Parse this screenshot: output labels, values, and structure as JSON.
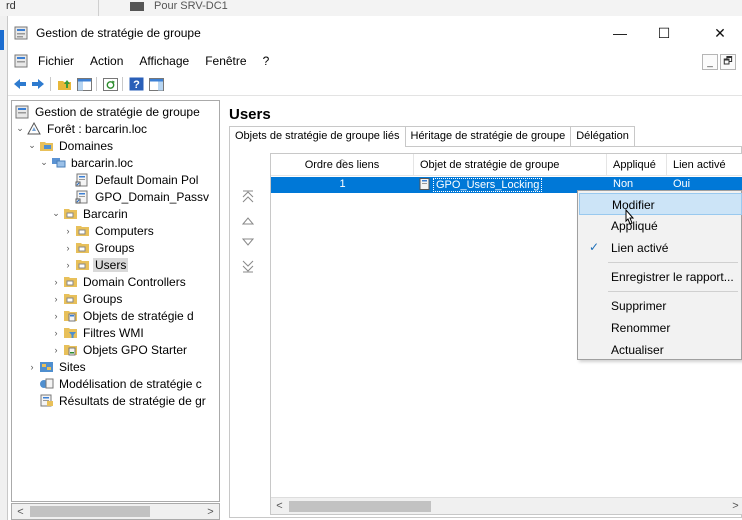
{
  "background": {
    "left_text": "rd",
    "window_text": "Pour SRV-DC1"
  },
  "window": {
    "title": "Gestion de stratégie de groupe",
    "controls": {
      "minimize": "—",
      "maximize": "☐",
      "close": "✕"
    }
  },
  "menu": {
    "items": [
      "Fichier",
      "Action",
      "Affichage",
      "Fenêtre",
      "?"
    ],
    "mdi_minimize": "_",
    "mdi_restore": "🗗"
  },
  "tree": {
    "items": [
      {
        "label": "Gestion de stratégie de groupe",
        "icon": "gpmc-icon",
        "expander": ""
      },
      {
        "label": "Forêt : barcarin.loc",
        "icon": "forest-icon",
        "expander": "⌄"
      },
      {
        "label": "Domaines",
        "icon": "domains-icon",
        "expander": "⌄"
      },
      {
        "label": "barcarin.loc",
        "icon": "domain-icon",
        "expander": "⌄"
      },
      {
        "label": "Default Domain Pol",
        "icon": "gpo-link-icon",
        "expander": ""
      },
      {
        "label": "GPO_Domain_Passv",
        "icon": "gpo-link-icon",
        "expander": ""
      },
      {
        "label": "Barcarin",
        "icon": "ou-folder-icon",
        "expander": "⌄"
      },
      {
        "label": "Computers",
        "icon": "ou-folder-icon",
        "expander": "›"
      },
      {
        "label": "Groups",
        "icon": "ou-folder-icon",
        "expander": "›"
      },
      {
        "label": "Users",
        "icon": "ou-folder-icon",
        "expander": "›"
      },
      {
        "label": "Domain Controllers",
        "icon": "ou-folder-icon",
        "expander": "›"
      },
      {
        "label": "Groups",
        "icon": "ou-folder-icon",
        "expander": "›"
      },
      {
        "label": "Objets de stratégie d",
        "icon": "gpo-folder-icon",
        "expander": "›"
      },
      {
        "label": "Filtres WMI",
        "icon": "wmi-folder-icon",
        "expander": "›"
      },
      {
        "label": "Objets GPO Starter",
        "icon": "starter-gpo-icon",
        "expander": "›"
      },
      {
        "label": "Sites",
        "icon": "sites-icon",
        "expander": "›"
      },
      {
        "label": "Modélisation de stratégie c",
        "icon": "modeling-icon",
        "expander": ""
      },
      {
        "label": "Résultats de stratégie de gr",
        "icon": "results-icon",
        "expander": ""
      }
    ],
    "scroll_left": "<",
    "scroll_right": ">"
  },
  "panel": {
    "title": "Users",
    "tabs": [
      "Objets de stratégie de groupe liés",
      "Héritage de stratégie de groupe",
      "Délégation"
    ],
    "columns": [
      "Ordre des liens",
      "Objet de stratégie de groupe",
      "Appliqué",
      "Lien activé"
    ],
    "rows": [
      {
        "order": "1",
        "gpo": "GPO_Users_Locking",
        "enforced": "Non",
        "link_enabled": "Oui"
      }
    ],
    "scroll_left": "<",
    "scroll_right": ">"
  },
  "context_menu": {
    "items": [
      "Modifier",
      "Appliqué",
      "Lien activé",
      "Enregistrer le rapport...",
      "Supprimer",
      "Renommer",
      "Actualiser"
    ],
    "checked": "✓"
  },
  "colors": {
    "selection": "#0078d7",
    "menu_hover": "#cce4f7",
    "check": "#1e6fb8"
  }
}
